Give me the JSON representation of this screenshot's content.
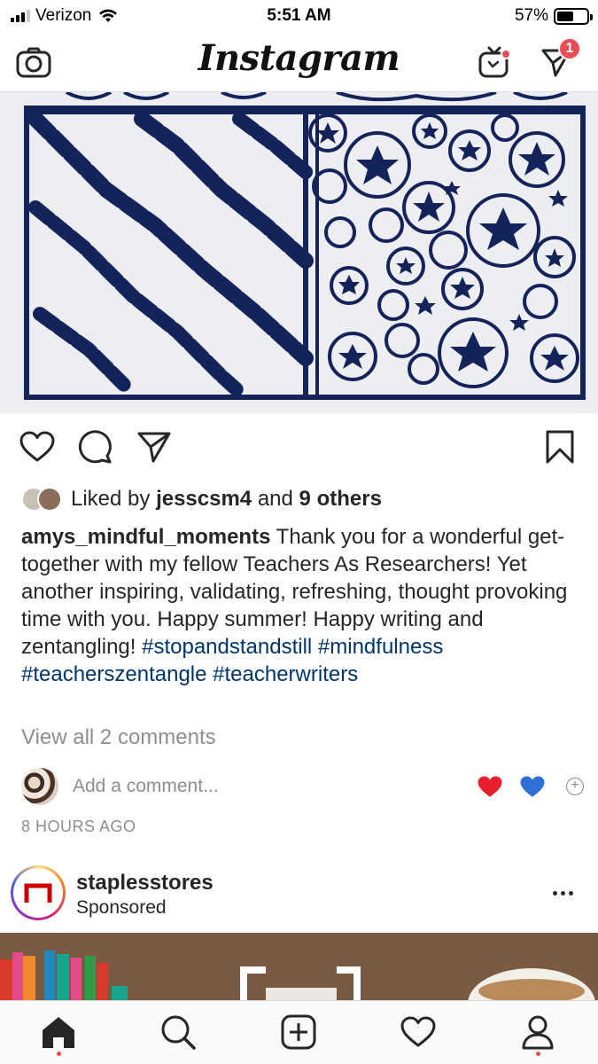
{
  "status_bar": {
    "carrier": "Verizon",
    "time": "5:51 AM",
    "battery_percent": "57%",
    "battery_level": 0.57,
    "icons": [
      "signal-icon",
      "wifi-icon",
      "battery-icon"
    ]
  },
  "header": {
    "logo_text": "Instagram",
    "left_icon": "camera-icon",
    "right_icons": [
      "igtv-icon",
      "direct-message-icon"
    ],
    "direct_badge": "1",
    "igtv_has_new": true
  },
  "post": {
    "image_description_icon": "zentangle-artwork",
    "actions": [
      "heart-icon",
      "comment-icon",
      "share-icon",
      "bookmark-icon"
    ],
    "likes": {
      "prefix": "Liked by",
      "user": "jesscsm4",
      "conjunction": "and",
      "others": "9 others"
    },
    "caption": {
      "username": "amys_mindful_moments",
      "text": "Thank you for a wonderful get-together with my fellow Teachers As Researchers!  Yet another inspiring, validating, refreshing, thought provoking time with you.  Happy summer!  Happy writing and zentangling!",
      "hashtags": "#stopandstandstill #mindfulness #teacherszentangle #teacherwriters"
    },
    "view_comments": "View all 2 comments",
    "add_comment_placeholder": "Add a comment...",
    "quick_reactions": [
      "❤️",
      "💙"
    ],
    "time_ago": "8 HOURS AGO"
  },
  "sponsored": {
    "username": "staplesstores",
    "label": "Sponsored"
  },
  "tab_bar": {
    "tabs": [
      "home-icon",
      "search-icon",
      "new-post-icon",
      "activity-icon",
      "profile-icon"
    ],
    "active": "home-icon"
  },
  "colors": {
    "accent_red": "#ed4956",
    "hashtag_blue": "#003569",
    "muted_gray": "#8e8e8e",
    "ink_navy": "#14235a"
  }
}
